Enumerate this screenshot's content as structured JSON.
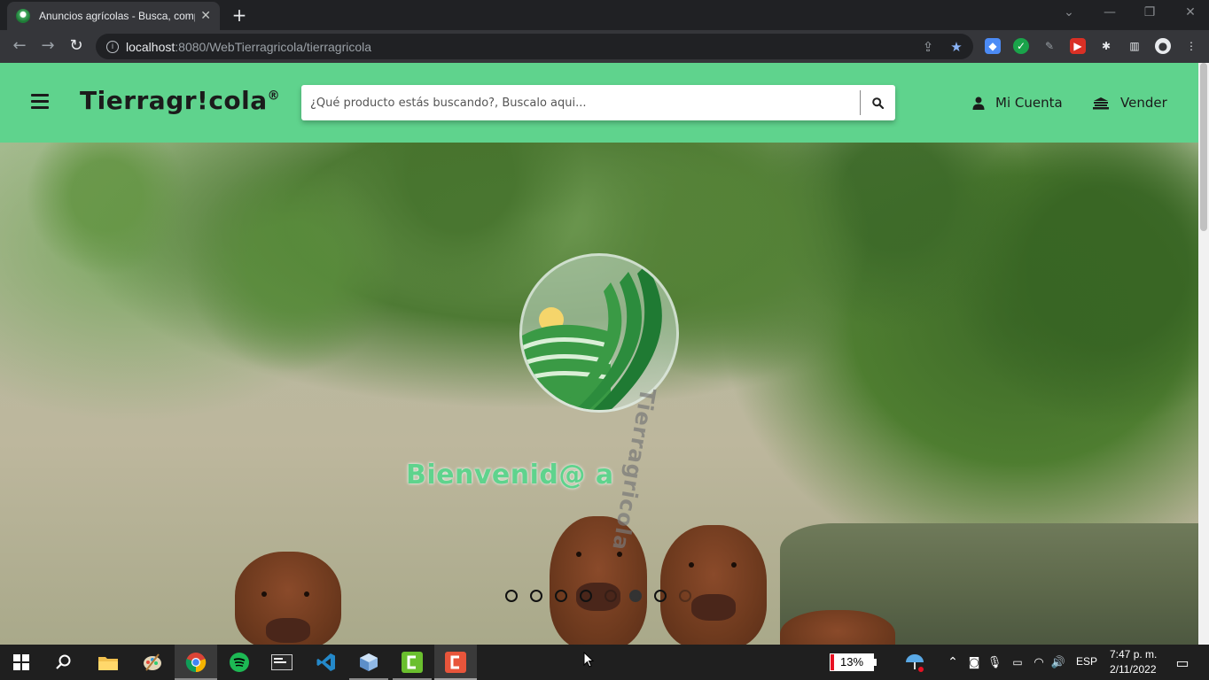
{
  "browser": {
    "tab_title": "Anuncios agrícolas - Busca, compra",
    "url_host": "localhost",
    "url_rest": ":8080/WebTierragricola/tierragricola"
  },
  "site": {
    "brand": "Tierragr!cola",
    "brand_mark": "®",
    "search_placeholder": "¿Qué producto estás buscando?, Buscalo aqui...",
    "nav": {
      "account_label": "Mi Cuenta",
      "sell_label": "Vender"
    },
    "accent_color": "#5fd38d"
  },
  "hero": {
    "welcome_text": "Bienvenid@ a",
    "vertical_brand": "Tierragricola",
    "carousel_dots": 8,
    "active_dot": 6
  },
  "taskbar": {
    "battery": "13%",
    "language": "ESP",
    "time": "7:47 p. m.",
    "date": "2/11/2022"
  }
}
